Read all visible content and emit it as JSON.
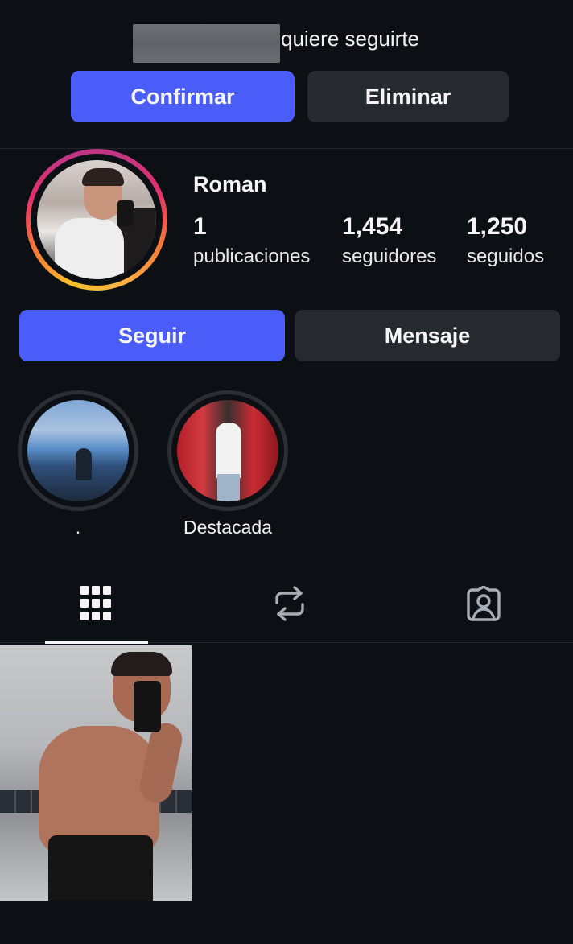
{
  "request": {
    "text": "quiere seguirte",
    "confirm_label": "Confirmar",
    "delete_label": "Eliminar"
  },
  "profile": {
    "username": "Roman",
    "stats": [
      {
        "value": "1",
        "label": "publicaciones"
      },
      {
        "value": "1,454",
        "label": "seguidores"
      },
      {
        "value": "1,250",
        "label": "seguidos"
      }
    ],
    "follow_label": "Seguir",
    "message_label": "Mensaje"
  },
  "highlights": [
    {
      "label": "."
    },
    {
      "label": "Destacada"
    }
  ],
  "tabs": [
    {
      "icon": "grid-icon",
      "active": true
    },
    {
      "icon": "reels-icon",
      "active": false
    },
    {
      "icon": "tagged-icon",
      "active": false
    }
  ],
  "colors": {
    "background": "#0c1014",
    "primary_button": "#4a5df9",
    "secondary_button": "#262a30"
  }
}
